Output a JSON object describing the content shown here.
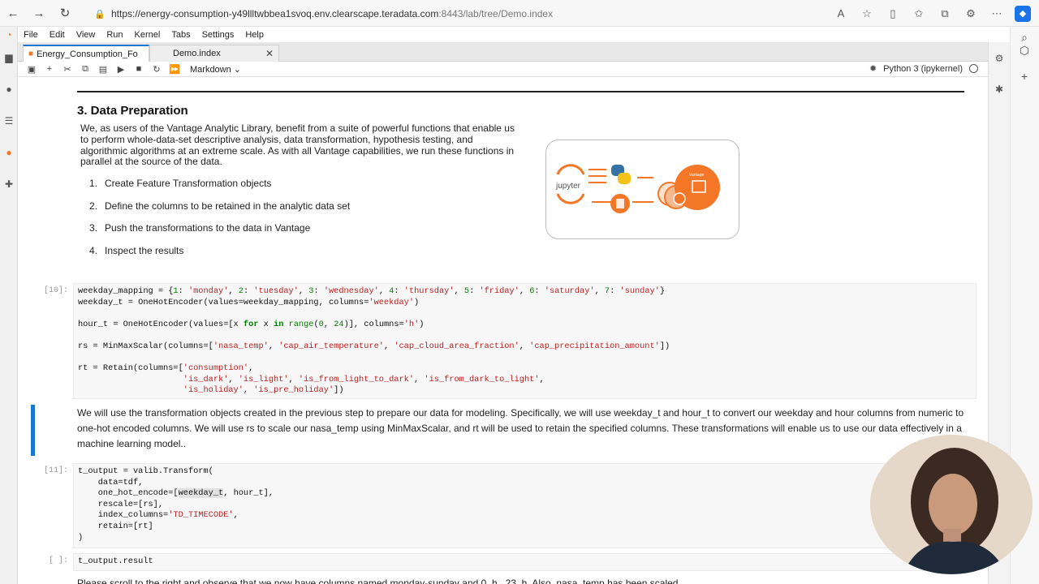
{
  "browser": {
    "url_main": "https://energy-consumption-y49llltwbbea1svoq.env.clearscape.teradata.com",
    "url_rest": ":8443/lab/tree/Demo.index"
  },
  "menu": [
    "File",
    "Edit",
    "View",
    "Run",
    "Kernel",
    "Tabs",
    "Settings",
    "Help"
  ],
  "tabs": [
    {
      "label": "Energy_Consumption_Fo"
    },
    {
      "label": "Demo.index"
    }
  ],
  "toolbar": {
    "cell_type": "Markdown",
    "kernel": "Python 3 (ipykernel)"
  },
  "section": {
    "title": "3. Data Preparation",
    "intro": "We, as users of the Vantage Analytic Library, benefit from a suite of powerful functions that enable us to perform whole-data-set descriptive analysis, data transformation, hypothesis testing, and algorithmic algorithms at an extreme scale. As with all Vantage capabilities, we run these functions in parallel at the source of the data.",
    "steps": [
      {
        "num": "1.",
        "text": "Create Feature Transformation objects"
      },
      {
        "num": "2.",
        "text": "Define the columns to be retained in the analytic data set"
      },
      {
        "num": "3.",
        "text": "Push the transformations to the data in Vantage"
      },
      {
        "num": "4.",
        "text": "Inspect the results"
      }
    ]
  },
  "diagram": {
    "jupyter_label": "jupyter",
    "vantage_label": "Vantage"
  },
  "cells": {
    "c10_prompt": "[10]:",
    "c11_prompt": "[11]:",
    "c_empty_prompt": "[ ]:",
    "markdown": "We will use the transformation objects created in the previous step to prepare our data for modeling. Specifically, we will use weekday_t and hour_t to convert our weekday and hour columns from numeric to one-hot encoded columns. We will use rs to scale our nasa_temp using MinMaxScalar, and rt will be used to retain the specified columns. These transformations will enable us to use our data effectively in a machine learning model..",
    "cut_line": "Please scroll to the right and observe that we now have columns named monday-sunday and 0_h...23_h. Also, nasa_temp has been scaled"
  },
  "colors": {
    "accent": "#1976d2",
    "jupyter_orange": "#f37726",
    "code_bg": "#f7f7f7"
  }
}
